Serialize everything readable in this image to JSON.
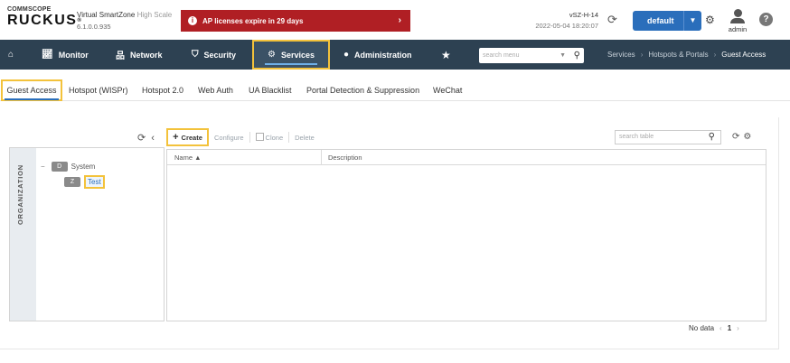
{
  "header": {
    "logo_top": "COMMSCOPE",
    "logo_main": "RUCKUS",
    "product_name": "Virtual SmartZone",
    "product_edition": "High Scale",
    "version": "6.1.0.0.935",
    "alert_text": "AP licenses expire in 29 days",
    "controller_name": "vSZ-H-14",
    "timestamp": "2022-05-04 18:20:07",
    "domain_label": "default",
    "user_name": "admin",
    "help_label": "?"
  },
  "nav": {
    "monitor": "Monitor",
    "network": "Network",
    "security": "Security",
    "services": "Services",
    "administration": "Administration",
    "search_placeholder": "search menu",
    "breadcrumb": [
      "Services",
      "Hotspots & Portals",
      "Guest Access"
    ]
  },
  "tabs": [
    "Guest Access",
    "Hotspot (WISPr)",
    "Hotspot 2.0",
    "Web Auth",
    "UA Blacklist",
    "Portal Detection & Suppression",
    "WeChat"
  ],
  "tree": {
    "org_label": "ORGANIZATION",
    "system_badge": "D",
    "system_label": "System",
    "zone_badge": "Z",
    "zone_label": "Test"
  },
  "toolbar": {
    "create": "Create",
    "configure": "Configure",
    "clone": "Clone",
    "delete": "Delete",
    "search_placeholder": "search table"
  },
  "table": {
    "columns": [
      "Name",
      "Description"
    ],
    "sort_indicator": "▲"
  },
  "pager": {
    "status": "No data",
    "page": "1"
  },
  "icons": {
    "home": "home-icon",
    "monitor": "chart-icon",
    "network": "network-icon",
    "security": "shield-icon",
    "services": "gears-icon",
    "administration": "person-icon",
    "favorite": "star-icon",
    "refresh": "refresh-icon",
    "settings": "gear-icon"
  },
  "colors": {
    "navbar": "#2d4152",
    "alert": "#b01f24",
    "accent": "#2a6ebb",
    "highlight": "#f3c23b"
  }
}
